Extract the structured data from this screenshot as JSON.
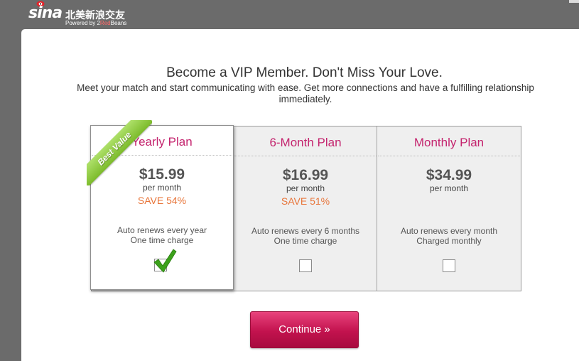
{
  "logo": {
    "brand": "sina",
    "tagline_cn": "北美新浪交友",
    "powered_prefix": "Powered by 2",
    "powered_red": "Red",
    "powered_suffix": "Beans"
  },
  "heading": "Become a VIP Member. Don't Miss Your Love.",
  "subheading": "Meet your match and start communicating with ease. Get more connections and have a fulfilling relationship immediately.",
  "ribbon": "Best Value",
  "plans": [
    {
      "name": "Yearly Plan",
      "price": "$15.99",
      "per": "per month",
      "save": "SAVE 54%",
      "renew": "Auto renews every year",
      "charge": "One time charge",
      "selected": true
    },
    {
      "name": "6-Month Plan",
      "price": "$16.99",
      "per": "per month",
      "save": "SAVE 51%",
      "renew": "Auto renews every 6 months",
      "charge": "One time charge",
      "selected": false
    },
    {
      "name": "Monthly Plan",
      "price": "$34.99",
      "per": "per month",
      "save": "",
      "renew": "Auto renews every month",
      "charge": "Charged monthly",
      "selected": false
    }
  ],
  "continue_label": "Continue »",
  "colors": {
    "plan_name": "#c4246e",
    "save": "#e8753a",
    "button": "#c2124e",
    "check": "#3ca11b",
    "ribbon": "#8ccb3b"
  },
  "icons": {
    "check": "check-mark-icon",
    "logo_eye": "sina-eye-icon"
  }
}
